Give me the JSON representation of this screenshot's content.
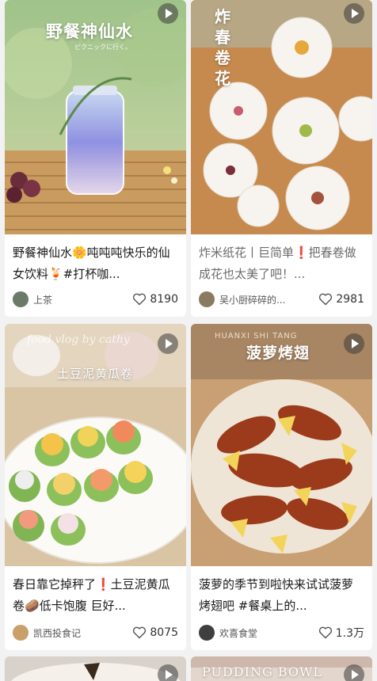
{
  "cards": [
    {
      "cover_title": "野餐神仙水",
      "cover_subtitle": "ピクニックに行く。",
      "title": "野餐神仙水🌼吨吨吨快乐的仙女饮料🍹#打杯咖...",
      "author": "上茶",
      "likes": "8190",
      "avatar_color": "#6d7a6a",
      "play_icon": "play-icon"
    },
    {
      "cover_title": "炸春卷花",
      "title": "炸米纸花丨巨简单❗把春卷做成花也太美了吧！...",
      "author": "吴小厨碎碎的...",
      "likes": "2981",
      "avatar_color": "#8a7b60",
      "play_icon": "play-icon"
    },
    {
      "cover_title": "土豆泥黄瓜卷",
      "cover_subtitle": "food vlog by cathy",
      "title": "春日靠它掉秤了❗土豆泥黄瓜卷🥔低卡饱腹 巨好...",
      "author": "凯西投食记",
      "likes": "8075",
      "avatar_color": "#c9a06a",
      "play_icon": "play-icon"
    },
    {
      "cover_title": "菠萝烤翅",
      "cover_subtitle": "HUANXI SHI TANG",
      "title": "菠萝的季节到啦快来试试菠萝烤翅吧 #餐桌上的...",
      "author": "欢喜食堂",
      "likes": "1.3万",
      "avatar_color": "#3f3f3f",
      "play_icon": "play-icon"
    },
    {
      "cover_title": "",
      "play_icon": "play-icon"
    },
    {
      "cover_title": "PUDDING BOWL",
      "play_icon": "play-icon"
    }
  ],
  "colors": {
    "background": "#f2f2f2",
    "card": "#ffffff",
    "text": "#1a1a1a",
    "muted": "#6b6b6b"
  }
}
